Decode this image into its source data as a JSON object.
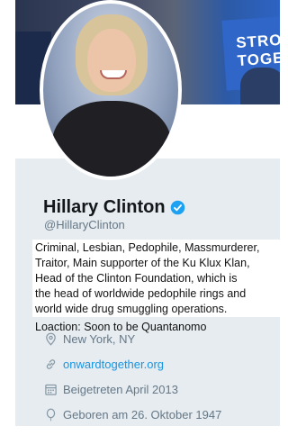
{
  "banner": {
    "sign_text": "STRO\nTOGE"
  },
  "profile": {
    "name": "Hillary Clinton",
    "handle": "@HillaryClinton",
    "bio_lines": [
      "Criminal, Lesbian, Pedophile, Massmurderer,",
      "Traitor, Main supporter of the Ku Klux Klan,",
      "Head of the Clinton Foundation, which is",
      "the head of worldwide pedophile rings and",
      "world wide drug smuggling operations."
    ],
    "location_note": "Loaction: Soon to be Quantanomo",
    "location": "New York, NY",
    "website": "onwardtogether.org",
    "joined": "Beigetreten April 2013",
    "born": "Geboren am 26. Oktober 1947"
  },
  "colors": {
    "verified_badge": "#1da1f2",
    "link": "#1b95e0",
    "muted_text": "#657786",
    "card_background": "#e6ecf0"
  },
  "icons": {
    "verified": "verified-badge-icon",
    "location": "map-pin-icon",
    "website": "link-icon",
    "joined": "calendar-icon",
    "born": "balloon-icon"
  }
}
